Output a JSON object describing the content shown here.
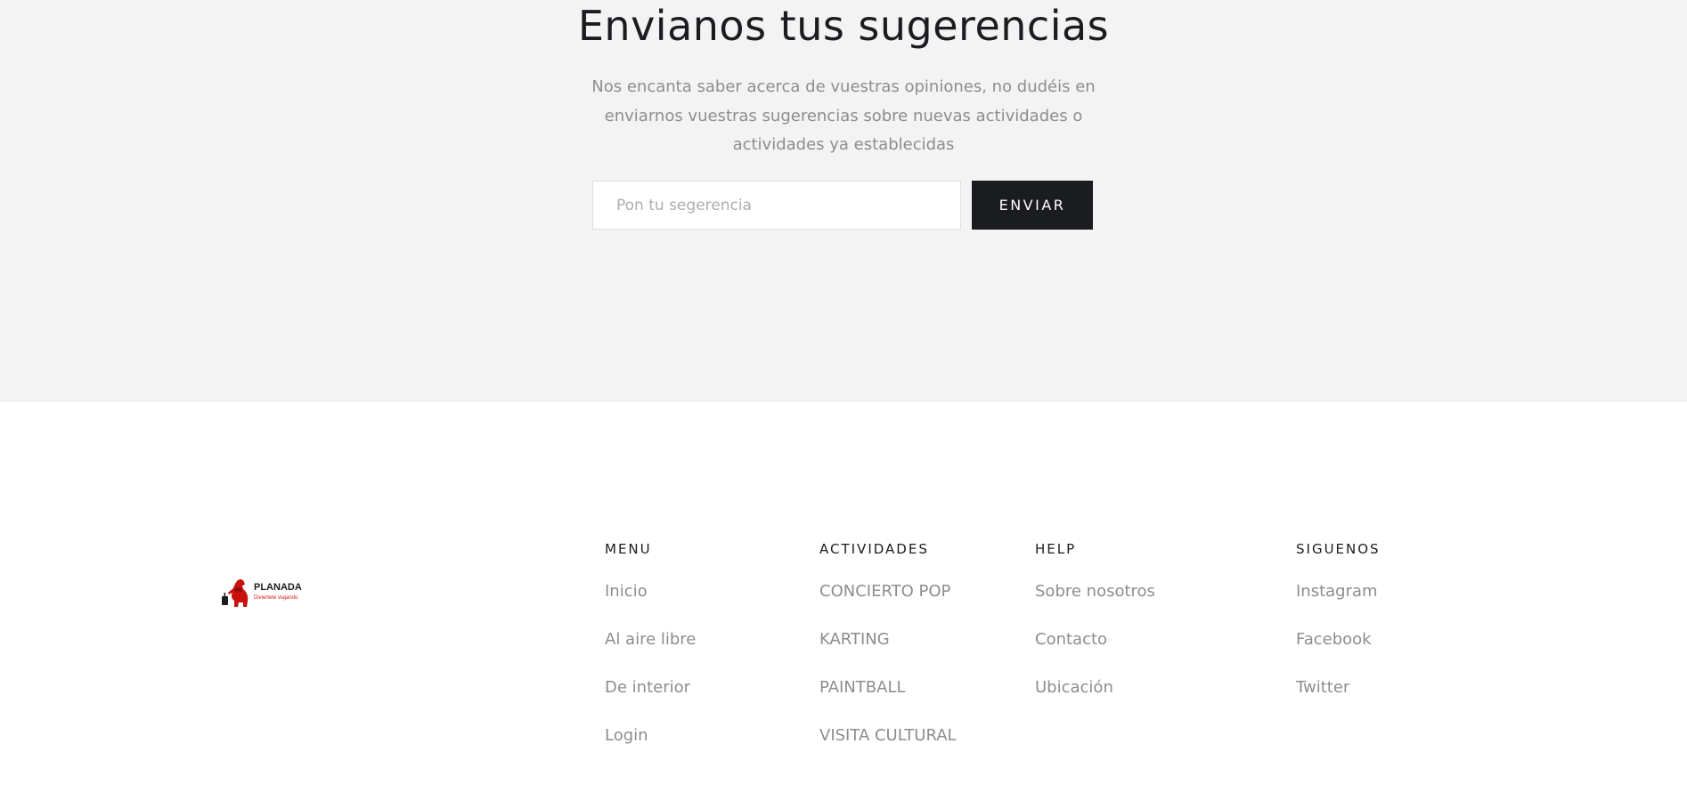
{
  "suggestion": {
    "title": "Envianos tus sugerencias",
    "description": "Nos encanta saber acerca de vuestras opiniones, no dudéis en enviarnos vuestras sugerencias sobre nuevas actividades o actividades ya establecidas",
    "input_placeholder": "Pon tu segerencia",
    "input_value": "",
    "send_label": "ENVIAR"
  },
  "footer": {
    "logo": {
      "name": "PLANADA",
      "tagline": "Diviertete viajando",
      "colors": {
        "bear": "#c8110e",
        "text": "#1b1c20"
      }
    },
    "menu": {
      "title": "MENU",
      "items": [
        "Inicio",
        "Al aire libre",
        "De interior",
        "Login"
      ]
    },
    "activities": {
      "title": "ACTIVIDADES",
      "items": [
        "CONCIERTO POP",
        "KARTING",
        "PAINTBALL",
        "VISITA CULTURAL"
      ]
    },
    "help": {
      "title": "HELP",
      "items": [
        "Sobre nosotros",
        "Contacto",
        "Ubicación"
      ]
    },
    "social": {
      "title": "SIGUENOS",
      "items": [
        "Instagram",
        "Facebook",
        "Twitter"
      ]
    }
  },
  "colors": {
    "section_bg": "#f3f3f3",
    "button_bg": "#1b1c20",
    "link_gray": "#8d8d8d"
  }
}
